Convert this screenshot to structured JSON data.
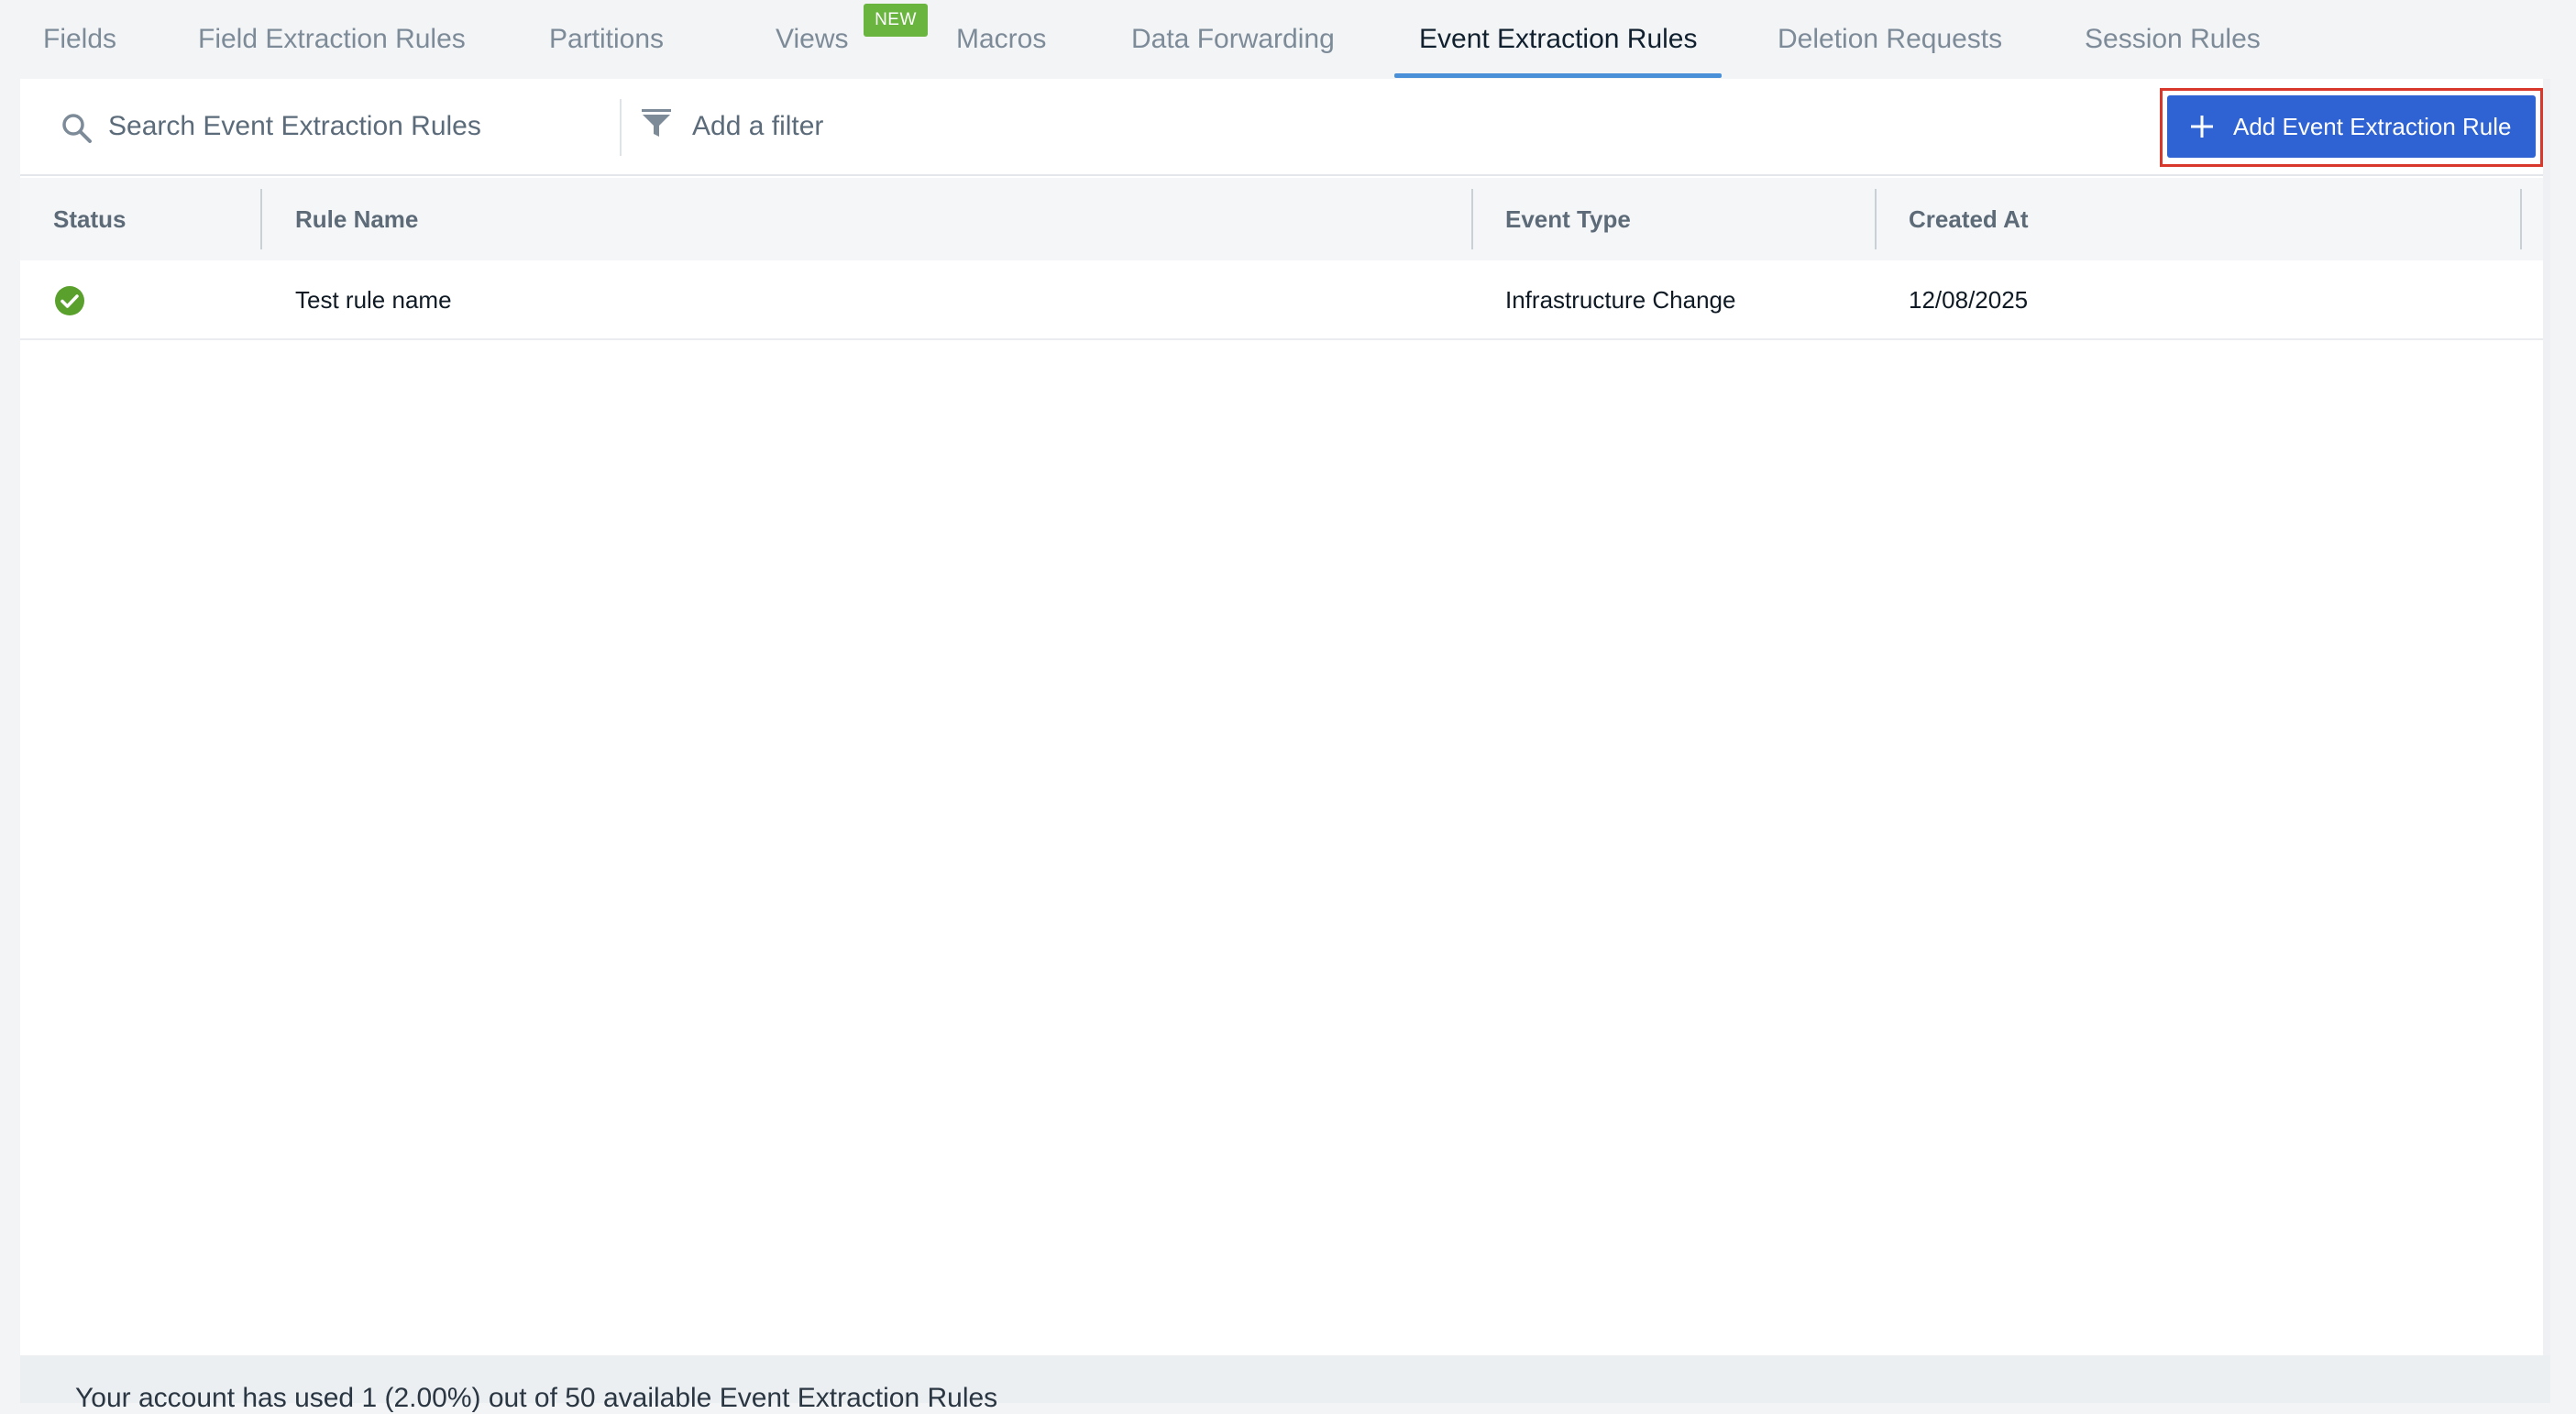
{
  "tabs": [
    {
      "label": "Fields",
      "active": false
    },
    {
      "label": "Field Extraction Rules",
      "active": false
    },
    {
      "label": "Partitions",
      "active": false
    },
    {
      "label": "Views",
      "active": false,
      "badge": "NEW"
    },
    {
      "label": "Macros",
      "active": false
    },
    {
      "label": "Data Forwarding",
      "active": false
    },
    {
      "label": "Event Extraction Rules",
      "active": true
    },
    {
      "label": "Deletion Requests",
      "active": false
    },
    {
      "label": "Session Rules",
      "active": false
    }
  ],
  "toolbar": {
    "search_placeholder": "Search Event Extraction Rules",
    "search_icon": "search-icon",
    "filter_label": "Add a filter",
    "filter_icon": "filter-icon",
    "add_button_label": "Add Event Extraction Rule",
    "add_button_icon": "plus-icon"
  },
  "table": {
    "headers": {
      "status": "Status",
      "rule_name": "Rule Name",
      "event_type": "Event Type",
      "created_at": "Created At"
    },
    "rows": [
      {
        "status": "enabled",
        "status_icon": "check-circle-icon",
        "rule_name": "Test rule name",
        "event_type": "Infrastructure Change",
        "created_at": "12/08/2025"
      }
    ]
  },
  "footer": {
    "usage_text": "Your account has used 1 (2.00%) out of 50 available Event Extraction Rules"
  },
  "colors": {
    "accent": "#2f63d3",
    "tab_underline": "#4a90d9",
    "badge": "#6ab53f",
    "status_ok": "#5aa02c",
    "highlight": "#d8382c"
  }
}
